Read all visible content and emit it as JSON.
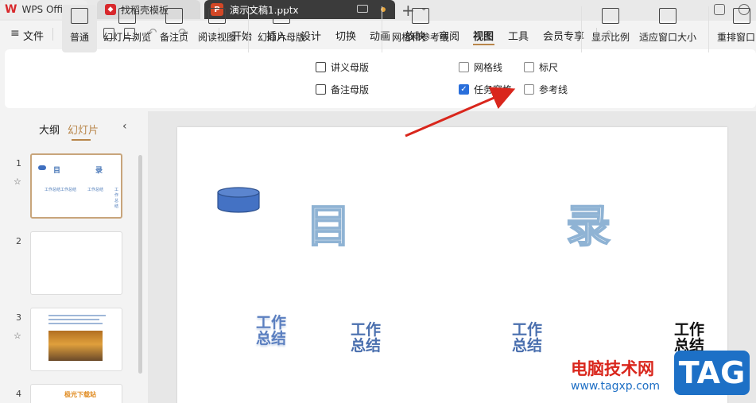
{
  "tabs": {
    "wps": "WPS Office",
    "template": "找稻壳模板",
    "document": "演示文稿1.pptx"
  },
  "menu": {
    "file": "文件",
    "items": [
      "开始",
      "插入",
      "设计",
      "切换",
      "动画",
      "放映",
      "审阅",
      "视图",
      "工具",
      "会员专享"
    ],
    "active": "视图"
  },
  "ribbon": {
    "normal": "普通",
    "slide_sorter": "幻灯片浏览",
    "notes_page": "备注页",
    "reading_view": "阅读视图",
    "slide_master": "幻灯片母版",
    "handout_master": "讲义母版",
    "notes_master": "备注母版",
    "grid_guides": "网格和参考线",
    "gridlines": "网格线",
    "task_pane": "任务窗格",
    "ruler": "标尺",
    "guides": "参考线",
    "zoom": "显示比例",
    "fit_window": "适应窗口大小",
    "arrange": "重排窗口"
  },
  "left_panel": {
    "outline_tab": "大纲",
    "slides_tab": "幻灯片",
    "slide_numbers": [
      "1",
      "2",
      "3",
      "4"
    ],
    "thumb1": {
      "title_a": "目",
      "title_b": "录",
      "mini": "工作总结"
    },
    "thumb4": {
      "title": "极光下载站"
    }
  },
  "slide": {
    "char_a": "目",
    "char_b": "录",
    "items": [
      {
        "line1": "工作",
        "line2": "总结"
      },
      {
        "line1": "工作",
        "line2": "总结"
      },
      {
        "line1": "工作",
        "line2": "总结"
      },
      {
        "line1": "工作",
        "line2": "总结"
      }
    ]
  },
  "watermark": {
    "site_name": "电脑技术网",
    "url": "www.tagxp.com",
    "badge": "TAG"
  },
  "colors": {
    "accent": "#b8864a",
    "checkbox_checked": "#2a6fdb",
    "arrow": "#d9261c",
    "slide_text": "#4a78b8"
  }
}
